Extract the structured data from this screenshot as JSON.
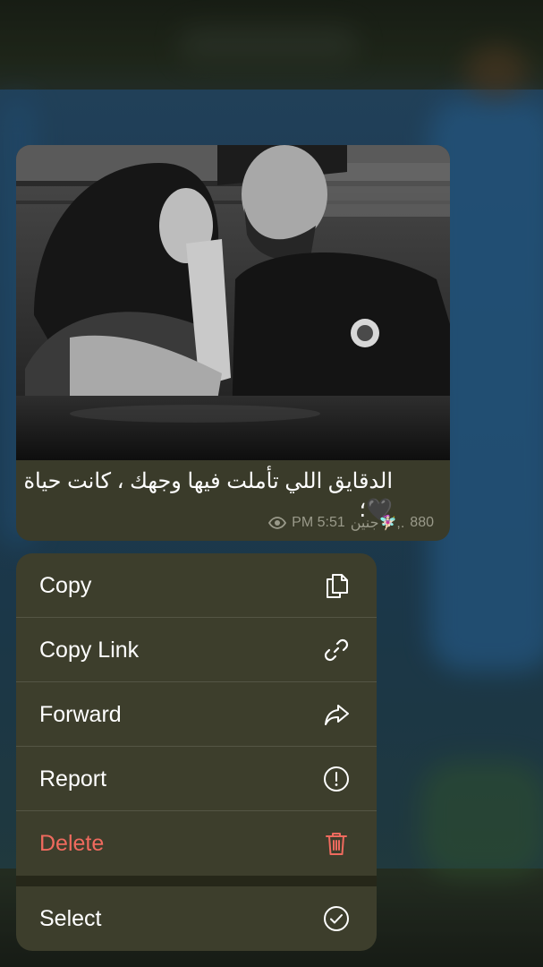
{
  "message": {
    "caption": "الدقايق اللي تأملت فيها وجهك ، كانت حياة🖤؛",
    "author": "جنين🧚🏻‍♀️,.",
    "time": "PM 5:51",
    "views": "880",
    "view-icon": "eye-icon"
  },
  "context_menu": {
    "items": [
      {
        "label": "Copy",
        "icon": "copy-icon"
      },
      {
        "label": "Copy Link",
        "icon": "link-icon"
      },
      {
        "label": "Forward",
        "icon": "forward-arrow-icon"
      },
      {
        "label": "Report",
        "icon": "exclamation-circle-icon"
      },
      {
        "label": "Delete",
        "icon": "trash-icon",
        "color": "#ef6a5e"
      },
      {
        "label": "Select",
        "icon": "checkmark-circle-icon"
      }
    ]
  }
}
